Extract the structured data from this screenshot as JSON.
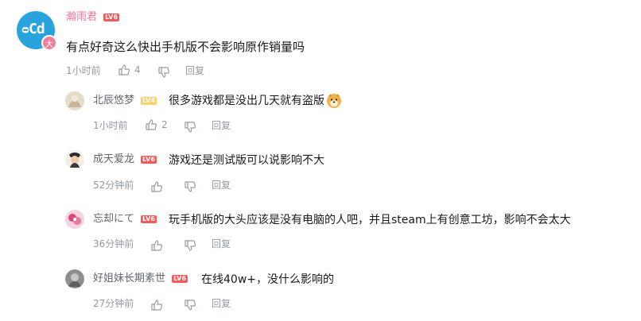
{
  "main_comment": {
    "avatar_text": "ᴑCd",
    "avatar_badge": "大",
    "username": "瀚雨君",
    "level": "LV6",
    "text": "有点好奇这么快出手机版不会影响原作销量吗",
    "time": "1小时前",
    "likes": "4",
    "reply_label": "回复"
  },
  "replies": [
    {
      "username": "北辰悠梦",
      "level": "LV4",
      "text": "很多游戏都是没出几天就有盗版",
      "time": "1小时前",
      "likes": "2",
      "reply_label": "回复"
    },
    {
      "username": "成天爱龙",
      "level": "LV6",
      "text": "游戏还是测试版可以说影响不大",
      "time": "52分钟前",
      "likes": "",
      "reply_label": "回复"
    },
    {
      "username": "忘却にて",
      "level": "LV6",
      "text": "玩手机版的大头应该是没有电脑的人吧，并且steam上有创意工坊，影响不会太大",
      "time": "36分钟前",
      "likes": "",
      "reply_label": "回复"
    },
    {
      "username": "好姐妹长期素世",
      "level": "LV6",
      "text": "在线40w+，没什么影响的",
      "time": "27分钟前",
      "likes": "",
      "reply_label": "回复"
    }
  ],
  "colors": {
    "accent": "#fb7299",
    "meta": "#9499a0",
    "level_red": "#f55a5a",
    "level_yellow": "#fbcf6a"
  },
  "icons": [
    "thumb-up-icon",
    "thumb-down-icon",
    "doge-emoji-icon"
  ]
}
